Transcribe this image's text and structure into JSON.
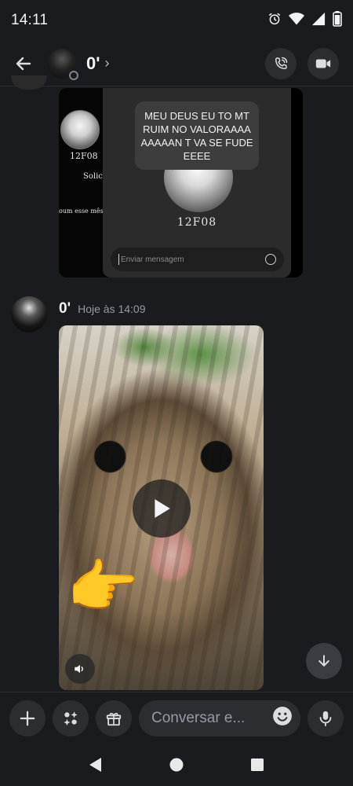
{
  "status_bar": {
    "time": "14:11",
    "icons": [
      "alarm-icon",
      "wifi-icon",
      "signal-icon",
      "battery-icon"
    ]
  },
  "header": {
    "name": "0'",
    "chevron": "›",
    "actions": [
      "voice-call-icon",
      "video-call-icon"
    ]
  },
  "screenshot_message": {
    "bubble_text": "MEU DEUS EU TO MT RUIM NO VALORAAAAAAAAAN T VA SE FUDEEEEE",
    "username_small": "12F08",
    "username_large": "12F08",
    "label_solicit": "Solicit",
    "label_esse_mes": "oum esse mês",
    "input_placeholder": "Enviar mensagem"
  },
  "video_message": {
    "author": "0'",
    "timestamp": "Hoje às 14:09",
    "emoji": "👉"
  },
  "composer": {
    "placeholder": "Conversar e..."
  },
  "colors": {
    "background": "#1a1b1e",
    "surface": "#2b2d31",
    "muted_text": "#949ba4"
  }
}
